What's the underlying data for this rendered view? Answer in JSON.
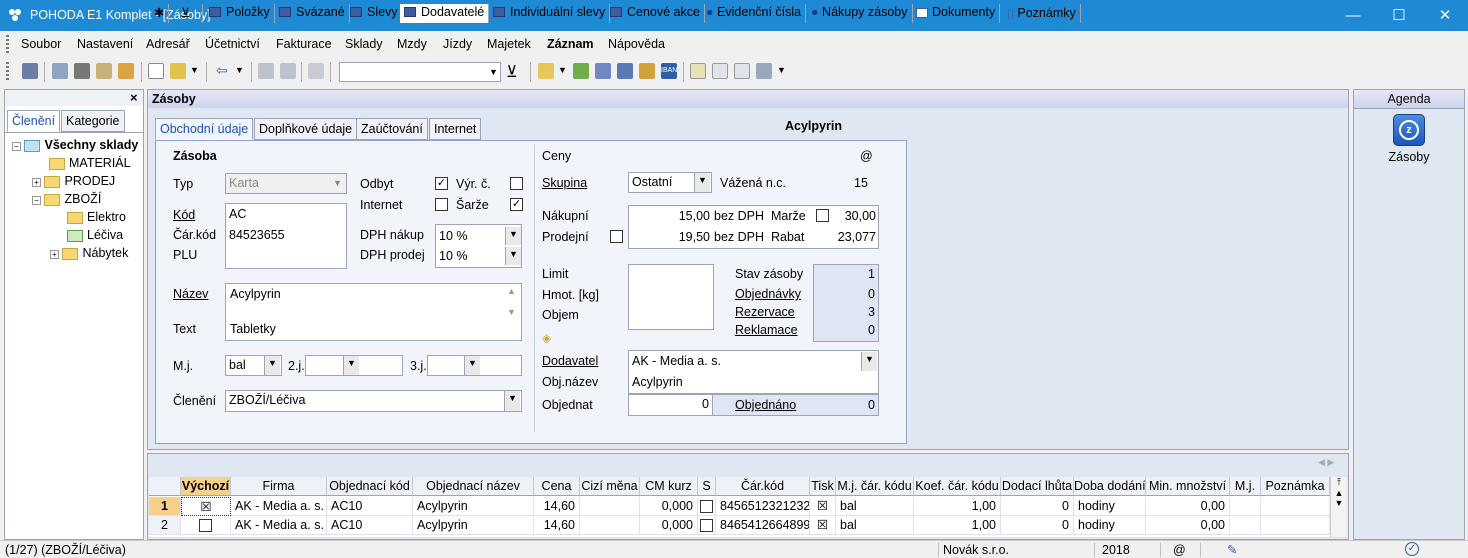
{
  "titlebar": {
    "title": "POHODA E1 Komplet - [Zásoby]",
    "minimize": "—",
    "maximize": "☐",
    "close": "✕"
  },
  "menu": [
    "Soubor",
    "Nastavení",
    "Adresář",
    "Účetnictví",
    "Fakturace",
    "Sklady",
    "Mzdy",
    "Jízdy",
    "Majetek",
    "Záznam",
    "Nápověda"
  ],
  "toolbar": {
    "search_value": ""
  },
  "left": {
    "close": "×",
    "tabs": [
      "Členění",
      "Kategorie"
    ],
    "tree": {
      "root": "Všechny sklady",
      "material": "MATERIÁL",
      "prodej": "PRODEJ",
      "zbozi": "ZBOŽÍ",
      "elektro": "Elektro",
      "leciva": "Léčiva",
      "nabytek": "Nábytek"
    }
  },
  "main": {
    "title": "Zásoby",
    "tabs": [
      "Obchodní údaje",
      "Doplňkové údaje",
      "Zaúčtování",
      "Internet"
    ],
    "record_name": "Acylpyrin",
    "zasoba": {
      "section": "Zásoba",
      "typ_label": "Typ",
      "typ": "Karta",
      "odbyt_label": "Odbyt",
      "internet_label": "Internet",
      "vyr_label": "Výr. č.",
      "sarze_label": "Šarže",
      "kod_label": "Kód",
      "carkod_label": "Čár.kód",
      "plu_label": "PLU",
      "kod": "AC",
      "carkod": "84523655",
      "plu": "",
      "dph_nakup_label": "DPH nákup",
      "dph_prodej_label": "DPH prodej",
      "dph_nakup": "10 %",
      "dph_prodej": "10 %",
      "nazev_label": "Název",
      "text_label": "Text",
      "nazev": "Acylpyrin",
      "text": "Tabletky",
      "mj_label": "M.j.",
      "mj": "bal",
      "mj2_label": "2.j.",
      "mj3_label": "3.j.",
      "cleneni_label": "Členění",
      "cleneni": "ZBOŽÍ/Léčiva"
    },
    "ceny": {
      "section": "Ceny",
      "at": "@",
      "skupina_label": "Skupina",
      "skupina": "Ostatní",
      "vazena_label": "Vážená n.c.",
      "vazena": "15",
      "nakupni_label": "Nákupní",
      "prodejni_label": "Prodejní",
      "nakupni": "15,00",
      "prodejni": "19,50",
      "bezdph1": "bez DPH",
      "bezdph2": "bez DPH",
      "marze_label": "Marže",
      "marze": "30,00",
      "rabat_label": "Rabat",
      "rabat": "23,077",
      "limit_label": "Limit",
      "hmot_label": "Hmot. [kg]",
      "objem_label": "Objem",
      "stav_label": "Stav zásoby",
      "stav": "1",
      "objednavky_label": "Objednávky",
      "objednavky": "0",
      "rezervace_label": "Rezervace",
      "rezervace": "3",
      "reklamace_label": "Reklamace",
      "reklamace": "0",
      "dodavatel_label": "Dodavatel",
      "dodavatel": "AK - Media a. s.",
      "objnazev_label": "Obj.název",
      "objnazev": "Acylpyrin",
      "objednat_label": "Objednat",
      "objednat": "0",
      "objednano_label": "Objednáno",
      "objednano": "0"
    }
  },
  "bottom": {
    "tabs": [
      "Položky",
      "Svázané",
      "Slevy",
      "Dodavatelé",
      "Individuální slevy",
      "Cenové akce",
      "Evidenční čísla",
      "Nákupy zásoby",
      "Dokumenty",
      "Poznámky"
    ],
    "columns": [
      "Výchozí",
      "Firma",
      "Objednací kód",
      "Objednací název",
      "Cena",
      "Cizí měna",
      "CM kurz",
      "S",
      "Čár.kód",
      "Tisk",
      "M.j. čár. kódu",
      "Koef. čár. kódu",
      "Dodací lhůta",
      "Doba dodání",
      "Min. množství",
      "M.j.",
      "Poznámka"
    ],
    "rows": [
      {
        "n": "1",
        "vychozi": "☒",
        "firma": "AK - Media a. s.",
        "kod": "AC10",
        "nazev": "Acylpyrin",
        "cena": "14,60",
        "cm": "",
        "kurz": "0,000",
        "s": "",
        "carkod": "8456512321232",
        "tisk": "☒",
        "mj": "bal",
        "koef": "1,00",
        "lhuta": "0",
        "doba": "hodiny",
        "min": "0,00",
        "mj2": "",
        "pozn": ""
      },
      {
        "n": "2",
        "vychozi": "",
        "firma": "AK - Media a. s.",
        "kod": "AC10",
        "nazev": "Acylpyrin",
        "cena": "14,60",
        "cm": "",
        "kurz": "0,000",
        "s": "",
        "carkod": "8465412664899",
        "tisk": "☒",
        "mj": "bal",
        "koef": "1,00",
        "lhuta": "0",
        "doba": "hodiny",
        "min": "0,00",
        "mj2": "",
        "pozn": ""
      }
    ]
  },
  "agenda": {
    "title": "Agenda",
    "item": "Zásoby"
  },
  "status": {
    "record": "(1/27) (ZBOŽÍ/Léčiva)",
    "company": "Novák s.r.o.",
    "year": "2018",
    "at": "@"
  }
}
